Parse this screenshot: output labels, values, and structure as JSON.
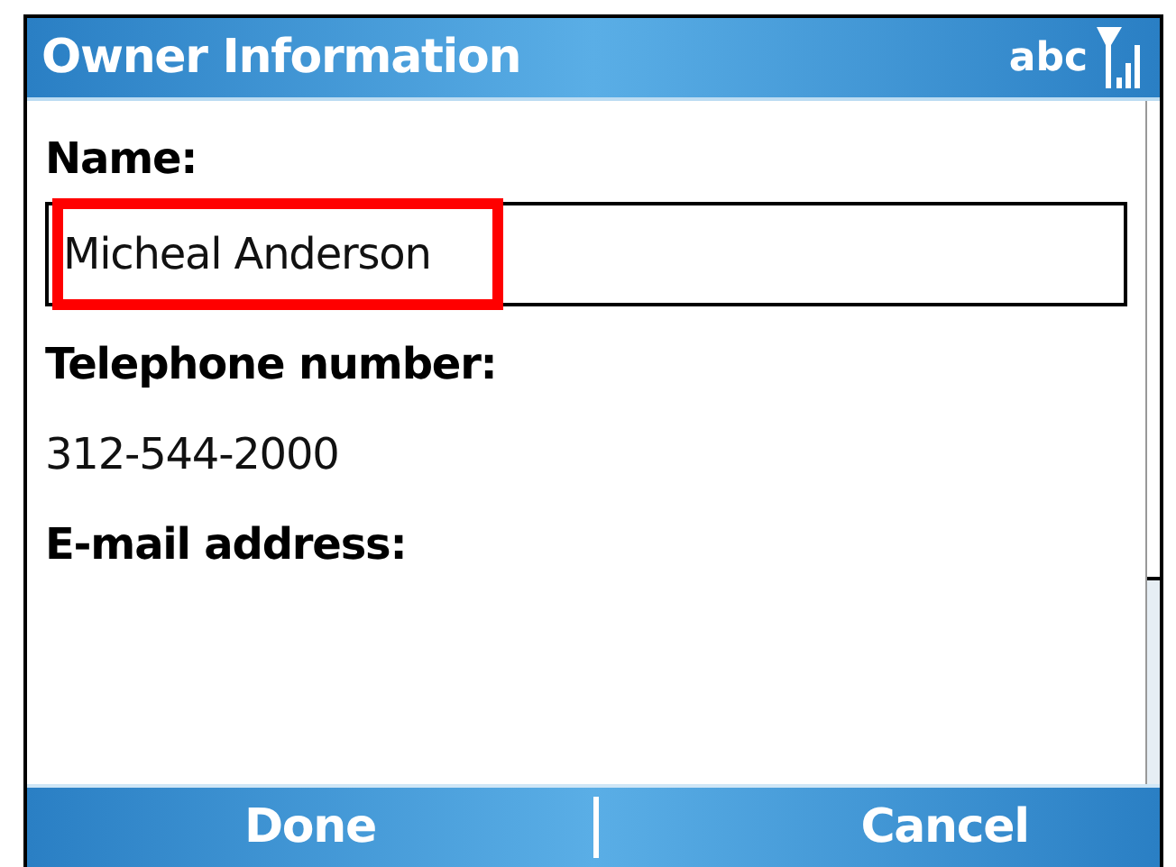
{
  "title_bar": {
    "title": "Owner Information",
    "input_mode": "abc"
  },
  "fields": [
    {
      "kind": "input",
      "label": "Name:",
      "value": "Micheal Anderson",
      "highlighted": true
    },
    {
      "kind": "text",
      "label": "Telephone number:",
      "value": "312-544-2000"
    },
    {
      "kind": "text",
      "label": "E-mail address:"
    }
  ],
  "softkeys": [
    "Done",
    "Cancel"
  ]
}
